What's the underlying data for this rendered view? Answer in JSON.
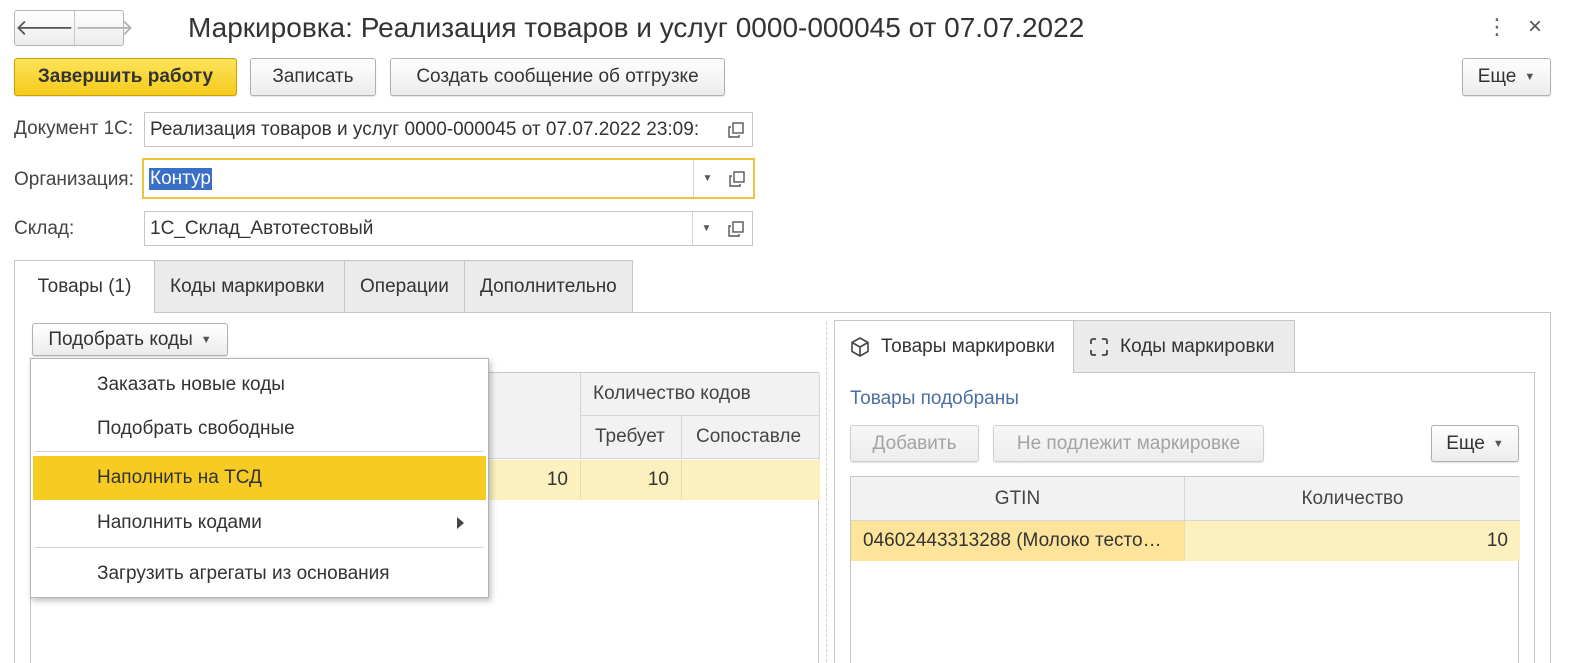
{
  "window": {
    "title": "Маркировка: Реализация товаров и услуг 0000-000045 от 07.07.2022",
    "back_glyph": "🡐",
    "forward_glyph": "🡒",
    "menu_glyph": "⋮",
    "close_glyph": "×"
  },
  "toolbar": {
    "finish_label": "Завершить работу",
    "save_label": "Записать",
    "create_message_label": "Создать сообщение об отгрузке",
    "more_label": "Еще"
  },
  "form": {
    "document_label": "Документ 1С:",
    "document_value": "Реализация товаров и услуг 0000-000045 от 07.07.2022 23:09:",
    "organization_label": "Организация:",
    "organization_value": "Контур",
    "warehouse_label": "Склад:",
    "warehouse_value": "1С_Склад_Автотестовый"
  },
  "tabs": [
    {
      "label": "Товары (1)",
      "active": true
    },
    {
      "label": "Коды маркировки",
      "active": false
    },
    {
      "label": "Операции",
      "active": false
    },
    {
      "label": "Дополнительно",
      "active": false
    }
  ],
  "left": {
    "pick_codes_label": "Подобрать коды",
    "grid": {
      "group_header": "Количество кодов",
      "col_required": "Требует",
      "col_matched": "Сопоставле",
      "row": {
        "quantity": "10",
        "required": "10",
        "matched": ""
      }
    }
  },
  "menu": {
    "items": [
      {
        "label": "Заказать новые коды"
      },
      {
        "label": "Подобрать свободные"
      },
      {
        "label": "Наполнить на ТСД"
      },
      {
        "label": "Наполнить кодами"
      },
      {
        "label": "Загрузить агрегаты из основания"
      }
    ]
  },
  "right": {
    "subtabs": [
      {
        "label": "Товары маркировки",
        "active": true
      },
      {
        "label": "Коды маркировки",
        "active": false
      }
    ],
    "status_text": "Товары подобраны",
    "add_label": "Добавить",
    "not_marked_label": "Не подлежит маркировке",
    "more_label": "Еще",
    "grid": {
      "col_gtin": "GTIN",
      "col_quantity": "Количество",
      "row": {
        "gtin": "04602443313288 (Молоко тесто…",
        "quantity": "10"
      }
    }
  },
  "colors": {
    "accent_yellow": "#f6cb23",
    "row_highlight": "#fdf0bf",
    "selection_blue": "#3a6fc8",
    "link_blue": "#4a6fa0"
  }
}
